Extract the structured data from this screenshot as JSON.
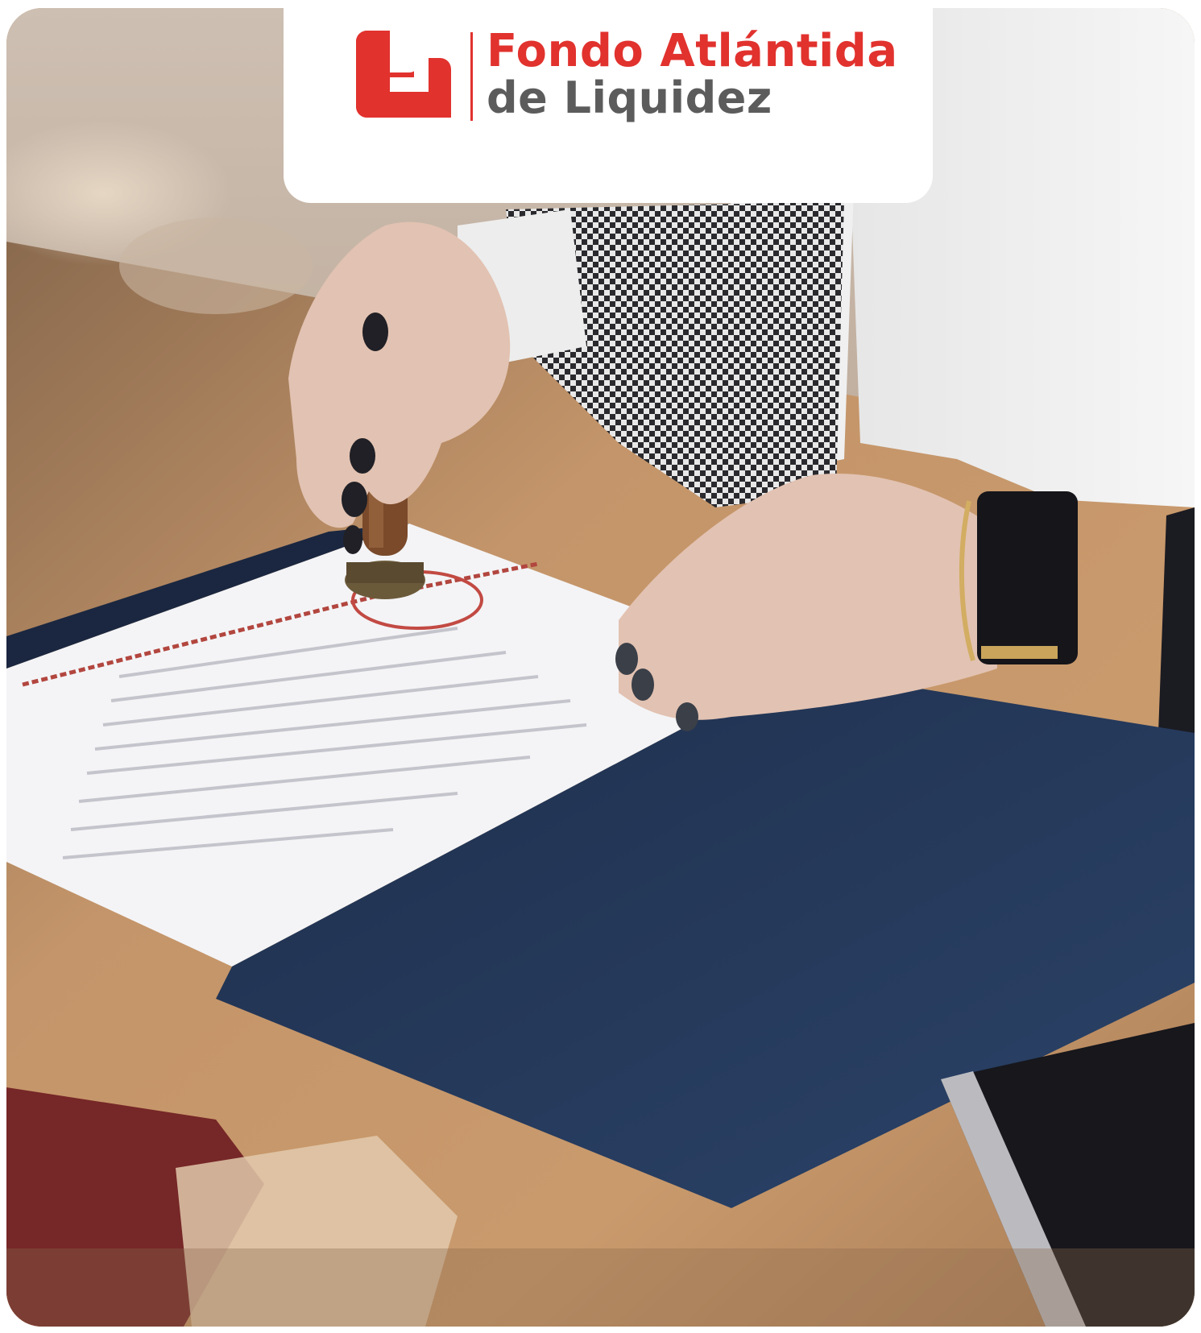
{
  "brand": {
    "name_line1": "Fondo Atlántida",
    "name_line2": "de Liquidez",
    "accent_color": "#e1322e",
    "secondary_color": "#5c5c5c"
  },
  "photo": {
    "icons": [
      "logo-mark-icon",
      "hand-stamp-icon",
      "document-icon",
      "folder-icon"
    ]
  }
}
